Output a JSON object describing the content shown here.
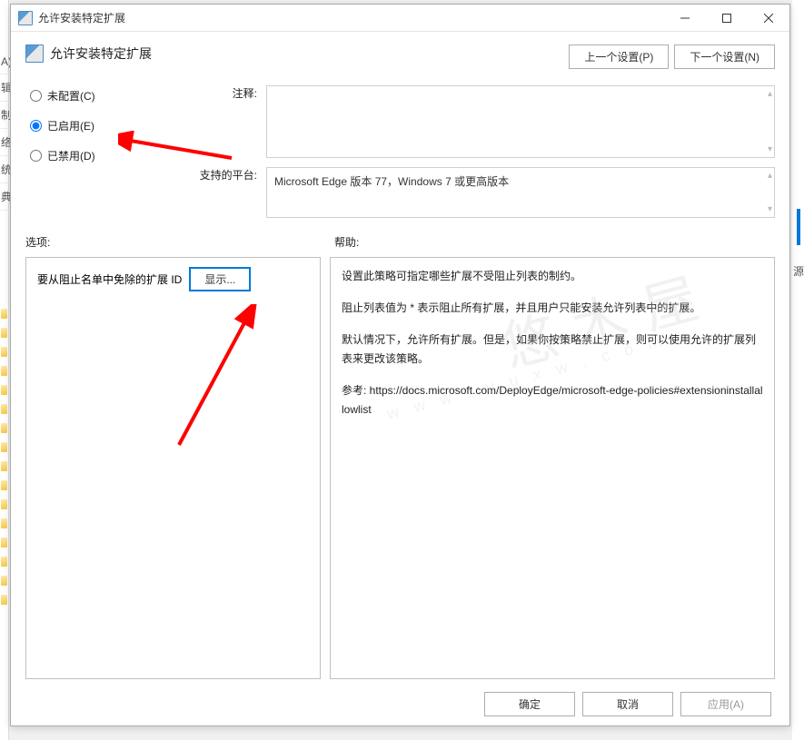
{
  "left_sidebar": [
    "",
    "A)",
    "",
    "",
    "辑",
    "",
    "",
    "",
    "制",
    "络",
    "统",
    "典"
  ],
  "titlebar": {
    "title": "允许安装特定扩展"
  },
  "header": {
    "title": "允许安装特定扩展",
    "prev": "上一个设置(P)",
    "next": "下一个设置(N)"
  },
  "radios": {
    "not_configured": "未配置(C)",
    "enabled": "已启用(E)",
    "disabled": "已禁用(D)"
  },
  "labels": {
    "comment": "注释:",
    "platform": "支持的平台:",
    "options": "选项:",
    "help": "帮助:",
    "option_row": "要从阻止名单中免除的扩展 ID",
    "show_btn": "显示..."
  },
  "platform_text": "Microsoft Edge 版本 77，Windows 7 或更高版本",
  "help_paragraphs": [
    "设置此策略可指定哪些扩展不受阻止列表的制约。",
    "阻止列表值为 * 表示阻止所有扩展，并且用户只能安装允许列表中的扩展。",
    "默认情况下，允许所有扩展。但是，如果你按策略禁止扩展，则可以使用允许的扩展列表来更改该策略。",
    "参考: https://docs.microsoft.com/DeployEdge/microsoft-edge-policies#extensioninstallallowlist"
  ],
  "footer": {
    "ok": "确定",
    "cancel": "取消",
    "apply": "应用(A)"
  },
  "right_text": "源"
}
